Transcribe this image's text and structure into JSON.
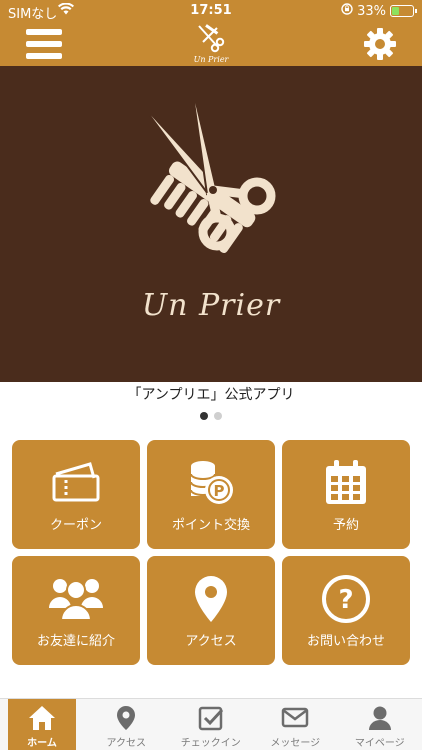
{
  "status_bar": {
    "carrier": "SIMなし",
    "time": "17:51",
    "battery": "33%",
    "battery_level": 0.33
  },
  "header": {
    "logo_text": "Un Prier",
    "menu_icon": "hamburger-icon",
    "settings_icon": "gear-icon"
  },
  "banner": {
    "brand": "Un Prier",
    "caption": "「アンプリエ」公式アプリ",
    "slides": 2,
    "active_slide": 1
  },
  "tiles": [
    {
      "label": "クーポン",
      "icon": "ticket-icon"
    },
    {
      "label": "ポイント交換",
      "icon": "coins-icon"
    },
    {
      "label": "予約",
      "icon": "calendar-icon"
    },
    {
      "label": "お友達に紹介",
      "icon": "users-icon"
    },
    {
      "label": "アクセス",
      "icon": "map-pin-icon"
    },
    {
      "label": "お問い合わせ",
      "icon": "question-icon"
    }
  ],
  "tabbar": [
    {
      "label": "ホーム",
      "icon": "home-icon",
      "active": true
    },
    {
      "label": "アクセス",
      "icon": "map-pin-icon",
      "active": false
    },
    {
      "label": "チェックイン",
      "icon": "checkin-icon",
      "active": false
    },
    {
      "label": "メッセージ",
      "icon": "mail-icon",
      "active": false
    },
    {
      "label": "マイページ",
      "icon": "user-icon",
      "active": false
    }
  ],
  "colors": {
    "accent": "#c68a33",
    "banner_bg": "#4a2c1c",
    "logo_cream": "#f2e2cc"
  }
}
